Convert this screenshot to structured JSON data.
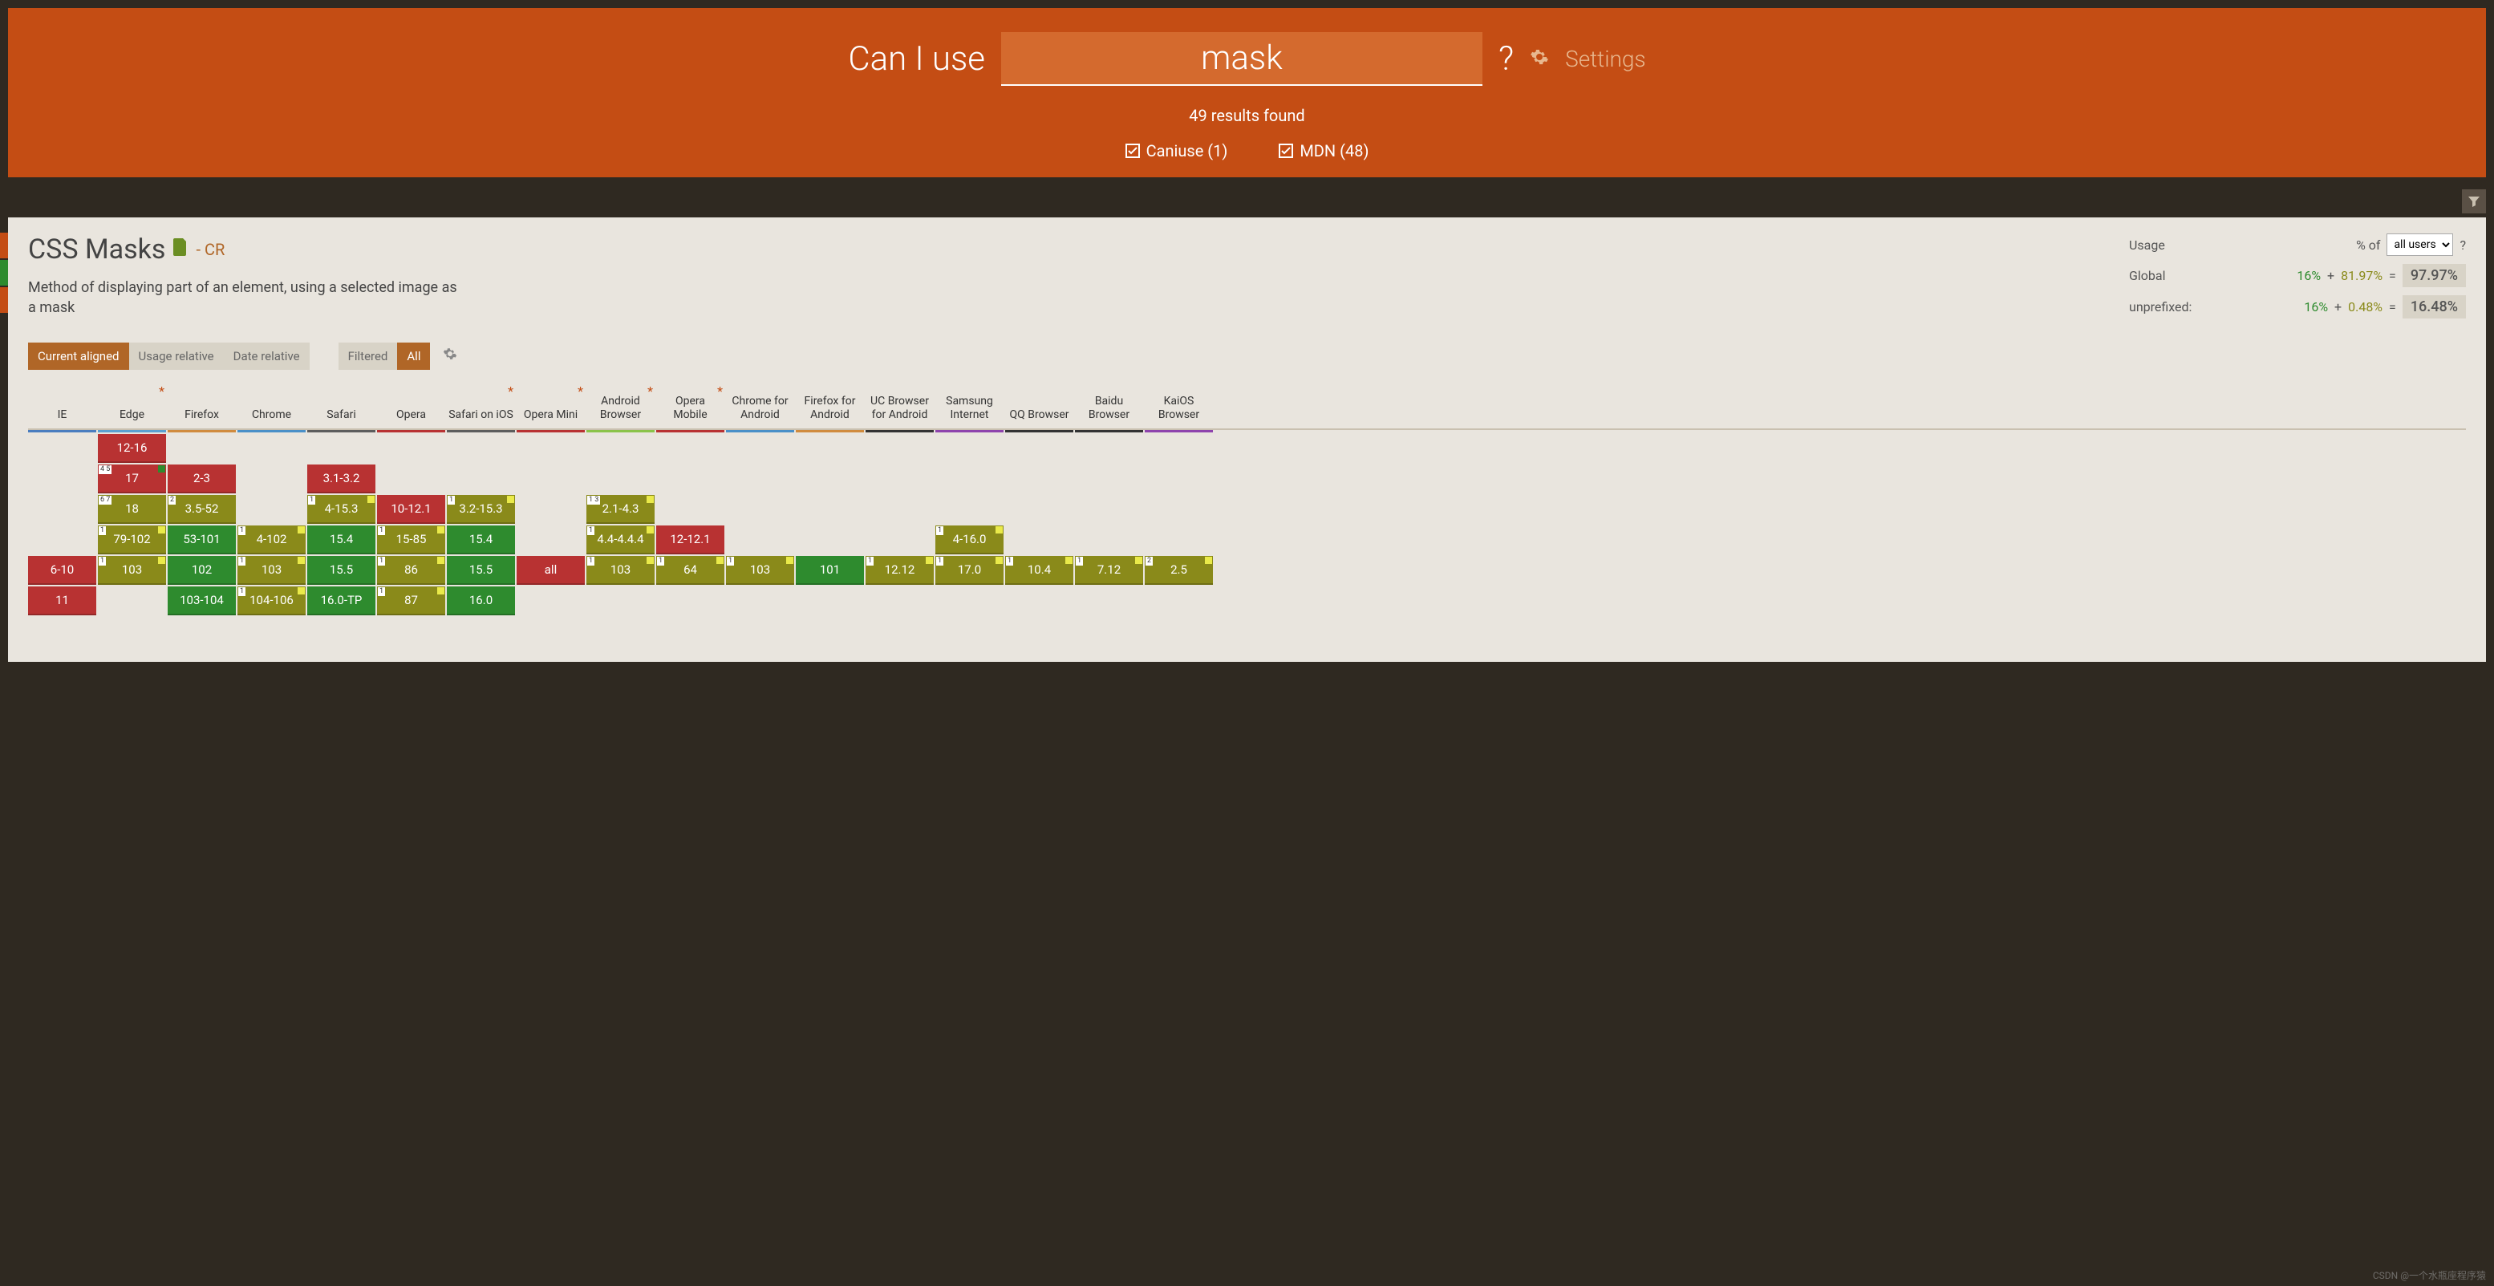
{
  "header": {
    "title": "Can I use",
    "search_value": "mask",
    "settings_label": "Settings",
    "results_text": "49 results found",
    "checks": [
      {
        "label": "Caniuse (1)"
      },
      {
        "label": "MDN (48)"
      }
    ]
  },
  "feature": {
    "title": "CSS Masks",
    "status": "- CR",
    "description": "Method of displaying part of an element, using a selected image as a mask"
  },
  "usage": {
    "label_usage": "Usage",
    "label_percent_of": "% of",
    "select_value": "all users",
    "help": "?",
    "rows": [
      {
        "lbl": "Global",
        "partial": "16%",
        "plus": "+",
        "full": "81.97%",
        "eq": "=",
        "total": "97.97%"
      },
      {
        "lbl": "unprefixed:",
        "partial": "16%",
        "plus": "+",
        "full": "0.48%",
        "eq": "=",
        "total": "16.48%"
      }
    ]
  },
  "tabs": {
    "view": [
      {
        "label": "Current aligned",
        "active": true
      },
      {
        "label": "Usage relative",
        "active": false
      },
      {
        "label": "Date relative",
        "active": false
      }
    ],
    "filter": [
      {
        "label": "Filtered",
        "active": false
      },
      {
        "label": "All",
        "active": true
      }
    ]
  },
  "browsers": [
    {
      "name": "IE",
      "cls": "ie",
      "ast": false
    },
    {
      "name": "Edge",
      "cls": "edge",
      "ast": true
    },
    {
      "name": "Firefox",
      "cls": "ff",
      "ast": false
    },
    {
      "name": "Chrome",
      "cls": "ch",
      "ast": false
    },
    {
      "name": "Safari",
      "cls": "sf",
      "ast": false
    },
    {
      "name": "Opera",
      "cls": "op",
      "ast": false
    },
    {
      "name": "Safari on iOS",
      "cls": "sios",
      "ast": true
    },
    {
      "name": "Opera Mini",
      "cls": "omini",
      "ast": true
    },
    {
      "name": "Android Browser",
      "cls": "ab",
      "ast": true
    },
    {
      "name": "Opera Mobile",
      "cls": "om",
      "ast": true
    },
    {
      "name": "Chrome for Android",
      "cls": "cfa",
      "ast": false
    },
    {
      "name": "Firefox for Android",
      "cls": "ffa",
      "ast": false
    },
    {
      "name": "UC Browser for Android",
      "cls": "uc",
      "ast": false
    },
    {
      "name": "Samsung Internet",
      "cls": "si",
      "ast": false
    },
    {
      "name": "QQ Browser",
      "cls": "qq",
      "ast": false
    },
    {
      "name": "Baidu Browser",
      "cls": "bb",
      "ast": false
    },
    {
      "name": "KaiOS Browser",
      "cls": "kai",
      "ast": false
    }
  ],
  "grid": [
    [
      null,
      null,
      null,
      null,
      {
        "v": "6-10",
        "c": "red"
      },
      {
        "v": "11",
        "c": "red"
      },
      null
    ],
    [
      {
        "v": "12-16",
        "c": "red"
      },
      {
        "v": "17",
        "c": "red",
        "note": "4 5",
        "flaggreen": true
      },
      {
        "v": "18",
        "c": "olive",
        "note": "6 7"
      },
      {
        "v": "79-102",
        "c": "olive",
        "note": "1",
        "flag": true
      },
      {
        "v": "103",
        "c": "olive",
        "note": "1",
        "flag": true
      },
      null,
      null
    ],
    [
      null,
      {
        "v": "2-3",
        "c": "red"
      },
      {
        "v": "3.5-52",
        "c": "olive",
        "note": "2"
      },
      {
        "v": "53-101",
        "c": "green"
      },
      {
        "v": "102",
        "c": "green"
      },
      {
        "v": "103-104",
        "c": "green"
      },
      null
    ],
    [
      null,
      null,
      null,
      {
        "v": "4-102",
        "c": "olive",
        "note": "1",
        "flag": true
      },
      {
        "v": "103",
        "c": "olive",
        "note": "1",
        "flag": true
      },
      {
        "v": "104-106",
        "c": "olive",
        "note": "1",
        "flag": true
      },
      null
    ],
    [
      null,
      {
        "v": "3.1-3.2",
        "c": "red"
      },
      {
        "v": "4-15.3",
        "c": "olive",
        "note": "1",
        "flag": true
      },
      {
        "v": "15.4",
        "c": "green"
      },
      {
        "v": "15.5",
        "c": "green"
      },
      {
        "v": "16.0-TP",
        "c": "green"
      },
      null
    ],
    [
      null,
      null,
      {
        "v": "10-12.1",
        "c": "red"
      },
      {
        "v": "15-85",
        "c": "olive",
        "note": "1",
        "flag": true
      },
      {
        "v": "86",
        "c": "olive",
        "note": "1",
        "flag": true
      },
      {
        "v": "87",
        "c": "olive",
        "note": "1",
        "flag": true
      },
      null
    ],
    [
      null,
      null,
      {
        "v": "3.2-15.3",
        "c": "olive",
        "note": "1",
        "flag": true
      },
      {
        "v": "15.4",
        "c": "green"
      },
      {
        "v": "15.5",
        "c": "green"
      },
      {
        "v": "16.0",
        "c": "green"
      },
      null
    ],
    [
      null,
      null,
      null,
      null,
      {
        "v": "all",
        "c": "red"
      },
      null,
      null
    ],
    [
      null,
      null,
      {
        "v": "2.1-4.3",
        "c": "olive",
        "note": "1 3",
        "flag": true
      },
      {
        "v": "4.4-4.4.4",
        "c": "olive",
        "note": "1",
        "flag": true
      },
      {
        "v": "103",
        "c": "olive",
        "note": "1",
        "flag": true
      },
      null,
      null
    ],
    [
      null,
      null,
      null,
      {
        "v": "12-12.1",
        "c": "red"
      },
      {
        "v": "64",
        "c": "olive",
        "note": "1",
        "flag": true
      },
      null,
      null
    ],
    [
      null,
      null,
      null,
      null,
      {
        "v": "103",
        "c": "olive",
        "note": "1",
        "flag": true
      },
      null,
      null
    ],
    [
      null,
      null,
      null,
      null,
      {
        "v": "101",
        "c": "green"
      },
      null,
      null
    ],
    [
      null,
      null,
      null,
      null,
      {
        "v": "12.12",
        "c": "olive",
        "note": "1",
        "flag": true
      },
      null,
      null
    ],
    [
      null,
      null,
      null,
      {
        "v": "4-16.0",
        "c": "olive",
        "note": "1",
        "flag": true
      },
      {
        "v": "17.0",
        "c": "olive",
        "note": "1",
        "flag": true
      },
      null,
      null
    ],
    [
      null,
      null,
      null,
      null,
      {
        "v": "10.4",
        "c": "olive",
        "note": "1",
        "flag": true
      },
      null,
      null
    ],
    [
      null,
      null,
      null,
      null,
      {
        "v": "7.12",
        "c": "olive",
        "note": "1",
        "flag": true
      },
      null,
      null
    ],
    [
      null,
      null,
      null,
      null,
      {
        "v": "2.5",
        "c": "olive",
        "note": "2",
        "flag": true
      },
      null,
      null
    ]
  ],
  "watermark": "CSDN @一个水瓶座程序猿"
}
